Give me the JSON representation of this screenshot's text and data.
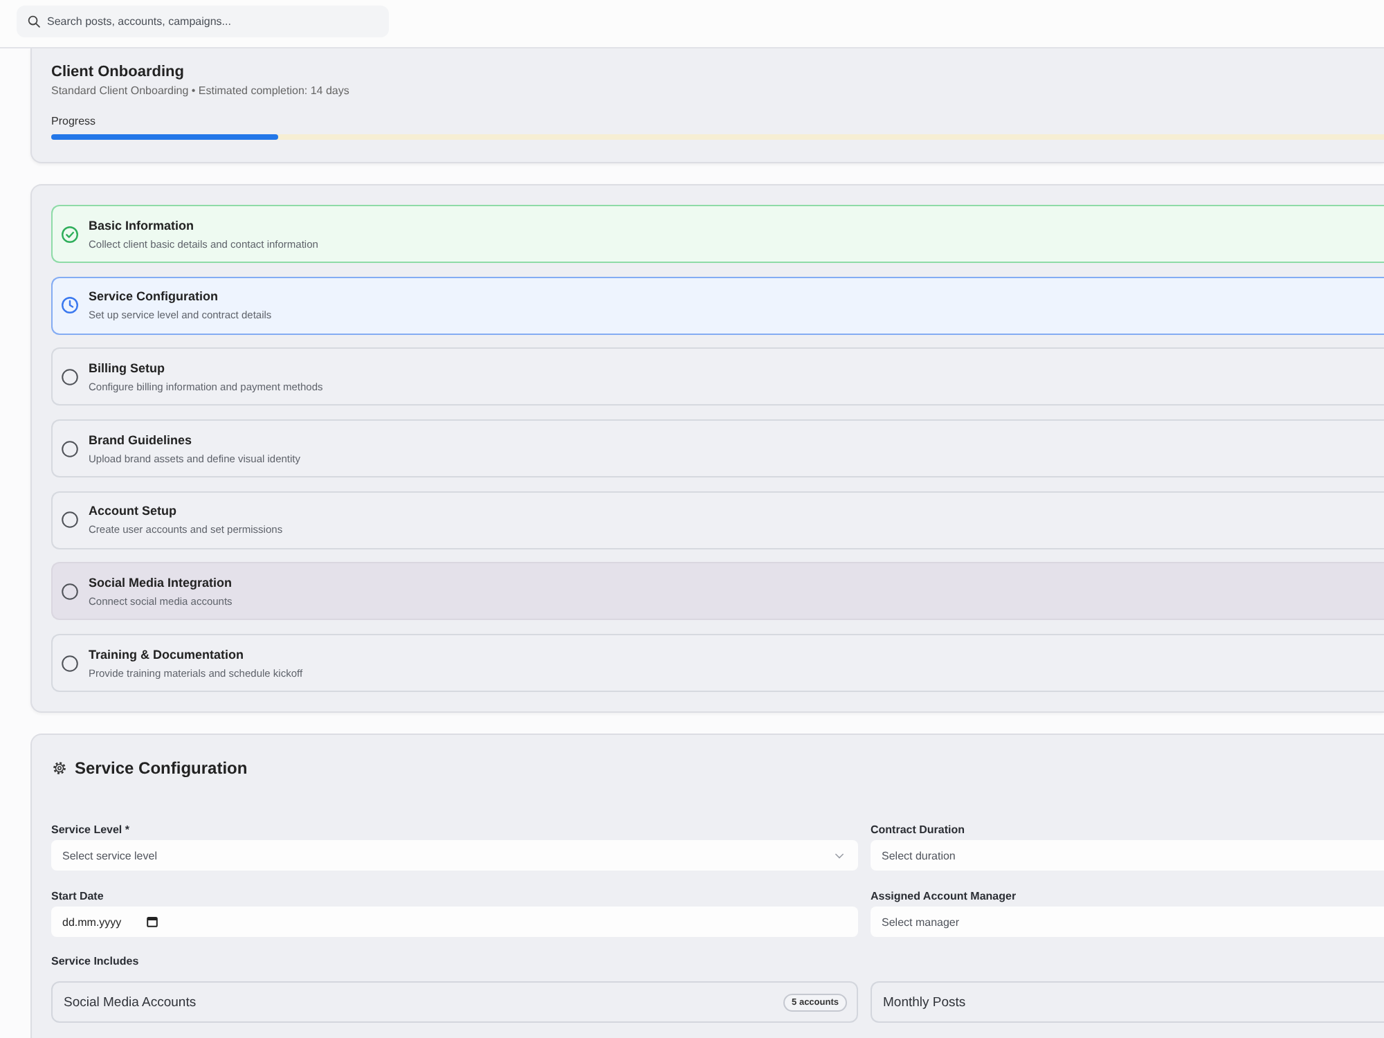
{
  "search": {
    "placeholder": "Search posts, accounts, campaigns..."
  },
  "onboarding": {
    "title": "Client Onboarding",
    "subtitle": "Standard Client Onboarding • Estimated completion: 14 days",
    "progress": {
      "label": "Progress",
      "level": 0.17
    }
  },
  "steps": [
    {
      "title": "Basic Information",
      "description": "Collect client basic details and contact information",
      "completed": true,
      "selected": false,
      "highlighted": false
    },
    {
      "title": "Service Configuration",
      "description": "Set up service level and contract details",
      "completed": false,
      "selected": true,
      "highlighted": false
    },
    {
      "title": "Billing Setup",
      "description": "Configure billing information and payment methods",
      "completed": false,
      "selected": false,
      "highlighted": false
    },
    {
      "title": "Brand Guidelines",
      "description": "Upload brand assets and define visual identity",
      "completed": false,
      "selected": false,
      "highlighted": false
    },
    {
      "title": "Account Setup",
      "description": "Create user accounts and set permissions",
      "completed": false,
      "selected": false,
      "highlighted": false
    },
    {
      "title": "Social Media Integration",
      "description": "Connect social media accounts",
      "completed": false,
      "selected": false,
      "highlighted": true
    },
    {
      "title": "Training & Documentation",
      "description": "Provide training materials and schedule kickoff",
      "completed": false,
      "selected": false,
      "highlighted": false
    }
  ],
  "service_configuration": {
    "title": "Service Configuration",
    "fields": [
      {
        "label": "Service Level *",
        "kind": "select",
        "placeholder": "Select service level",
        "chevron": true
      },
      {
        "label": "Contract Duration",
        "kind": "select",
        "placeholder": "Select duration",
        "chevron": false
      },
      {
        "label": "Start Date",
        "kind": "date",
        "placeholder": "dd.mm.yyyy"
      },
      {
        "label": "Assigned Account Manager",
        "kind": "select",
        "placeholder": "Select manager",
        "chevron": false
      }
    ],
    "includes": {
      "label": "Service Includes",
      "items": [
        {
          "label": "Social Media Accounts",
          "badge": "5 accounts"
        },
        {
          "label": "Monthly Posts"
        }
      ]
    }
  }
}
